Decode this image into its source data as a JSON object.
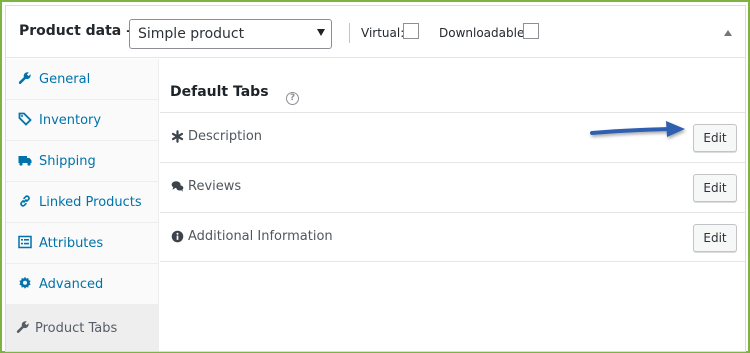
{
  "header": {
    "title": "Product data —",
    "product_type": "Simple product",
    "virtual_label": "Virtual:",
    "downloadable_label": "Downloadable:",
    "virtual_checked": false,
    "downloadable_checked": false
  },
  "sidebar": {
    "items": [
      {
        "label": "General",
        "icon": "wrench-icon",
        "active": false
      },
      {
        "label": "Inventory",
        "icon": "tag-icon",
        "active": false
      },
      {
        "label": "Shipping",
        "icon": "truck-icon",
        "active": false
      },
      {
        "label": "Linked Products",
        "icon": "link-icon",
        "active": false
      },
      {
        "label": "Attributes",
        "icon": "list-icon",
        "active": false
      },
      {
        "label": "Advanced",
        "icon": "gear-icon",
        "active": false
      },
      {
        "label": "Product Tabs",
        "icon": "wrench-icon",
        "active": true
      }
    ]
  },
  "main": {
    "title": "Default Tabs",
    "help": "?",
    "tabs": [
      {
        "label": "Description",
        "icon": "asterisk-icon",
        "button": "Edit"
      },
      {
        "label": "Reviews",
        "icon": "comments-icon",
        "button": "Edit"
      },
      {
        "label": "Additional Information",
        "icon": "info-icon",
        "button": "Edit"
      }
    ]
  },
  "colors": {
    "frame_border": "#7cb342",
    "link": "#0073aa",
    "annotation_arrow": "#2f5fb0"
  }
}
